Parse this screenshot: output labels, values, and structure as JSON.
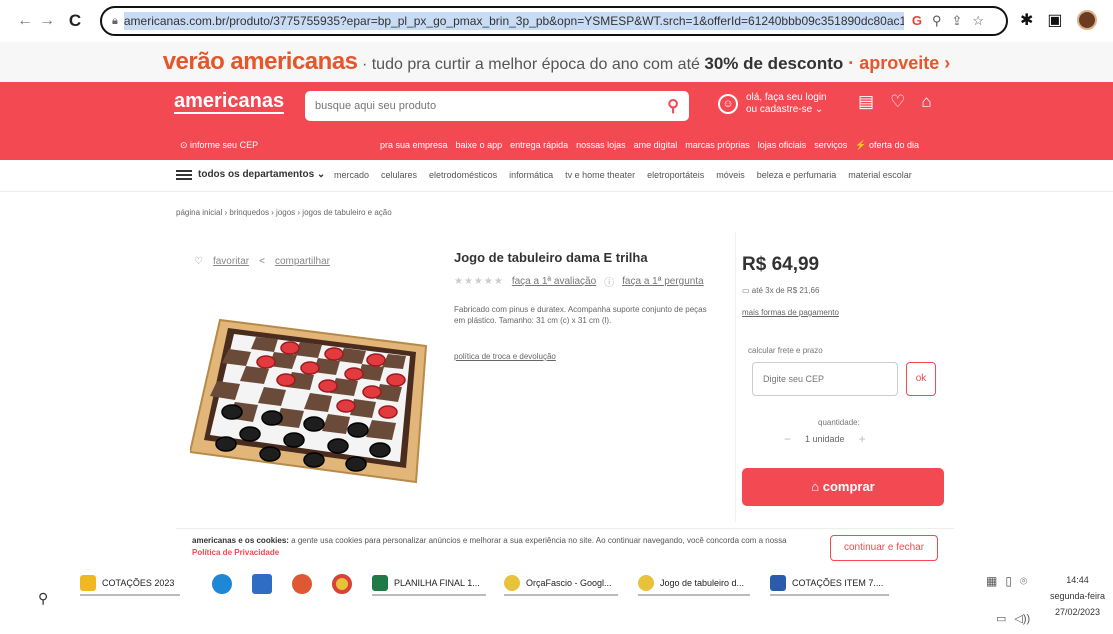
{
  "browser": {
    "url": "americanas.com.br/produto/3775755935?epar=bp_pl_px_go_pmax_brin_3p_pb&opn=YSMESP&WT.srch=1&offerId=61240bbb09c351890dc80ac1&gclid",
    "url_icons": [
      "G",
      "⚲",
      "⇪",
      "☆"
    ]
  },
  "promo": {
    "brand": "verão americanas",
    "text": " · tudo pra curtir a melhor época do ano com até ",
    "highlight": "30% de desconto",
    "link": " · aproveite ›"
  },
  "header": {
    "logo": "americanas",
    "search_placeholder": "busque aqui seu produto",
    "login_text": "olá, faça seu login ou cadastre-se ⌄",
    "cep": "⊙ informe seu CEP",
    "sublinks": [
      "pra sua empresa",
      "baixe o app",
      "entrega rápida",
      "nossas lojas",
      "ame digital",
      "marcas próprias",
      "lojas oficiais",
      "serviços",
      "⚡ oferta do dia"
    ]
  },
  "departments": {
    "all_label": "todos os departamentos ⌄",
    "links": [
      "mercado",
      "celulares",
      "eletrodomésticos",
      "informática",
      "tv e home theater",
      "eletroportáteis",
      "móveis",
      "beleza e perfumaria",
      "material escolar"
    ]
  },
  "breadcrumb": "página inicial  ›  brinquedos  ›  jogos  ›  jogos de tabuleiro e ação",
  "product": {
    "favorite": "favoritar",
    "share": "compartilhar",
    "title": "Jogo de tabuleiro dama E trilha",
    "stars": "★★★★★",
    "review_link": "faça a 1ª avaliação",
    "question_link": "faça a 1ª pergunta",
    "description": "Fabricado com pinus e duratex. Acompanha suporte conjunto de peças em plástico. Tamanho: 31 cm (c) x 31 cm (l).",
    "policy_link": "política de troca e devolução"
  },
  "buybox": {
    "price": "R$ 64,99",
    "installments": "até 3x de R$ 21,66",
    "payment_link": "mais formas de pagamento",
    "freight_label": "calcular frete e prazo",
    "cep_placeholder": "Digite seu CEP",
    "ok_label": "ok",
    "quantity_label": "quantidade:",
    "quantity_value": "1 unidade",
    "minus": "−",
    "plus": "+",
    "buy_label": "comprar"
  },
  "cookies": {
    "lead": "americanas e os cookies:",
    "text": " a gente usa cookies para personalizar anúncios e melhorar a sua experiência no site. Ao continuar navegando, você concorda com a nossa ",
    "link": "Política de Privacidade",
    "button": "continuar e fechar"
  },
  "taskbar": {
    "items": [
      "COTAÇÕES 2023",
      "PLANILHA FINAL 1...",
      "OrçaFascio - Googl...",
      "Jogo de tabuleiro d...",
      "COTAÇÕES ITEM 7...."
    ],
    "time": "14:44",
    "day": "segunda-feira",
    "date": "27/02/2023"
  },
  "colors": {
    "brand_red": "#f24952",
    "promo_orange": "#e5562a"
  }
}
